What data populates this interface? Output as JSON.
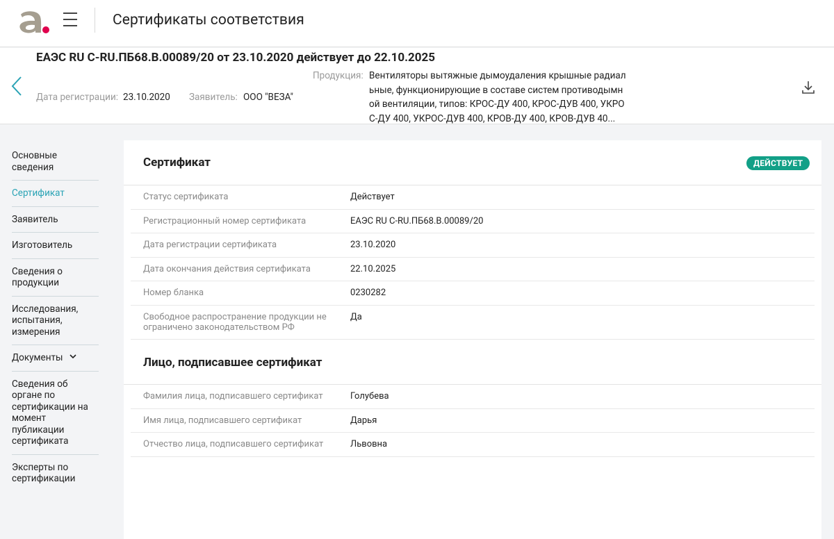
{
  "header": {
    "app_title": "Сертификаты соответствия",
    "brand_colors": {
      "dark": "#a59e90",
      "accent": "#e0004d"
    }
  },
  "summary": {
    "title": "ЕАЭС RU C-RU.ПБ68.В.00089/20 от 23.10.2020 действует до 22.10.2025",
    "reg_date_label": "Дата регистрации:",
    "reg_date_value": "23.10.2020",
    "applicant_label": "Заявитель:",
    "applicant_value": "ООО \"ВЕЗА\"",
    "product_label": "Продукция:",
    "product_value": "Вентиляторы вытяжные дымоудаления крышные радиальные, функционирующие в составе систем противодымной вентиляции, типов: КРОС-ДУ 400, КРОС-ДУВ 400, УКРОС-ДУ 400, УКРОС-ДУВ 400, КРОВ-ДУ 400, КРОВ-ДУВ 40..."
  },
  "sidebar": {
    "items": [
      {
        "label": "Основные сведения"
      },
      {
        "label": "Сертификат"
      },
      {
        "label": "Заявитель"
      },
      {
        "label": "Изготовитель"
      },
      {
        "label": "Сведения о продукции"
      },
      {
        "label": "Исследования, испытания, измерения"
      },
      {
        "label": "Документы"
      },
      {
        "label": "Сведения об органе по сертификации на момент публикации сертификата"
      },
      {
        "label": "Эксперты по сертификации"
      }
    ],
    "active_color": "#2aa3b5"
  },
  "certificate": {
    "heading": "Сертификат",
    "status_badge": "ДЕЙСТВУЕТ",
    "status_color": "#12a087",
    "rows": [
      {
        "key": "Статус сертификата",
        "value": "Действует"
      },
      {
        "key": "Регистрационный номер сертификата",
        "value": "ЕАЭС RU C-RU.ПБ68.В.00089/20"
      },
      {
        "key": "Дата регистрации сертификата",
        "value": "23.10.2020"
      },
      {
        "key": "Дата окончания действия сертификата",
        "value": "22.10.2025"
      },
      {
        "key": "Номер бланка",
        "value": "0230282"
      },
      {
        "key": "Свободное распространение продукции не ограничено законодательством РФ",
        "value": "Да"
      }
    ]
  },
  "signer": {
    "heading": "Лицо, подписавшее сертификат",
    "rows": [
      {
        "key": "Фамилия лица, подписавшего сертификат",
        "value": "Голубева"
      },
      {
        "key": "Имя лица, подписавшего сертификат",
        "value": "Дарья"
      },
      {
        "key": "Отчество лица, подписавшего сертификат",
        "value": "Львовна"
      }
    ]
  }
}
